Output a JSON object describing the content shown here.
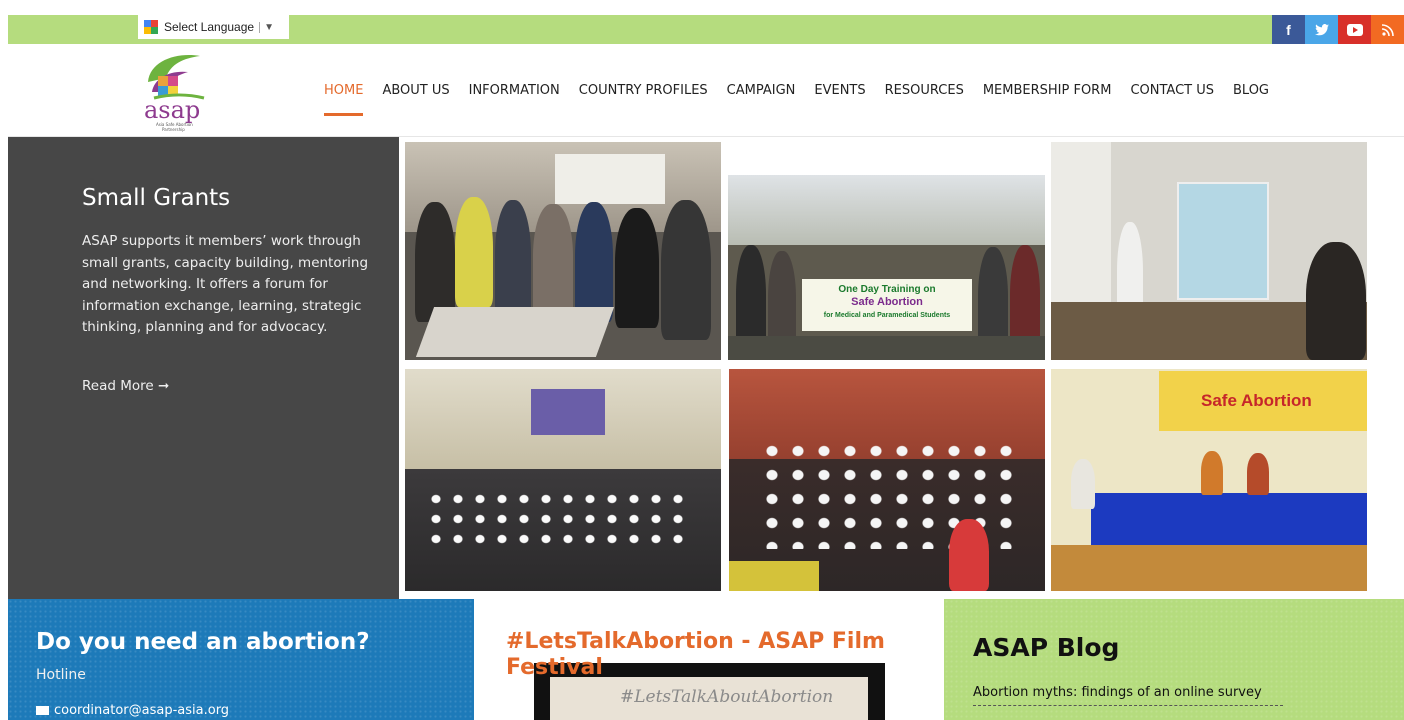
{
  "topbar": {
    "language_label": "Select Language",
    "language_arrow": "▼",
    "social": [
      {
        "name": "facebook-icon",
        "glyph": "f",
        "color": "#3b5998"
      },
      {
        "name": "twitter-icon",
        "glyph": "✓",
        "color": "#4aa6e8"
      },
      {
        "name": "youtube-icon",
        "glyph": "▶",
        "color": "#d8302a"
      },
      {
        "name": "rss-icon",
        "glyph": "))",
        "color": "#f26a22"
      }
    ]
  },
  "header": {
    "logo_text": "asap",
    "logo_tagline": "Asia Safe Abortion Partnership",
    "nav": [
      {
        "label": "HOME",
        "active": true
      },
      {
        "label": "ABOUT US"
      },
      {
        "label": "INFORMATION"
      },
      {
        "label": "COUNTRY PROFILES"
      },
      {
        "label": "CAMPAIGN"
      },
      {
        "label": "EVENTS"
      },
      {
        "label": "RESOURCES"
      },
      {
        "label": "MEMBERSHIP FORM"
      },
      {
        "label": "CONTACT US"
      },
      {
        "label": "BLOG"
      }
    ]
  },
  "hero": {
    "title": "Small Grants",
    "text": "ASAP supports it members’ work through small grants, capacity building, mentoring and networking. It offers a forum for information exchange, learning, strategic thinking, planning and for advocacy.",
    "read_more": "Read More ➞"
  },
  "photos": {
    "p2_banner_l1": "One Day Training on",
    "p2_banner_l2": "Safe Abortion",
    "p2_banner_l3": "for Medical and Paramedical Students",
    "p6_banner": "Safe Abortion"
  },
  "bottom": {
    "need": {
      "title": "Do you need an abortion?",
      "subtitle": "Hotline",
      "email": "coordinator@asap-asia.org"
    },
    "film": {
      "title": "#LetsTalkAbortion - ASAP Film Festival",
      "video_text": "#LetsTalkAboutAbortion"
    },
    "blog": {
      "title": "ASAP Blog",
      "post": "Abortion myths: findings of an online survey"
    }
  },
  "colors": {
    "accent": "#e46a2c",
    "topbar": "#b5dc7e",
    "blue": "#1d7ab9",
    "dark": "#474747"
  }
}
